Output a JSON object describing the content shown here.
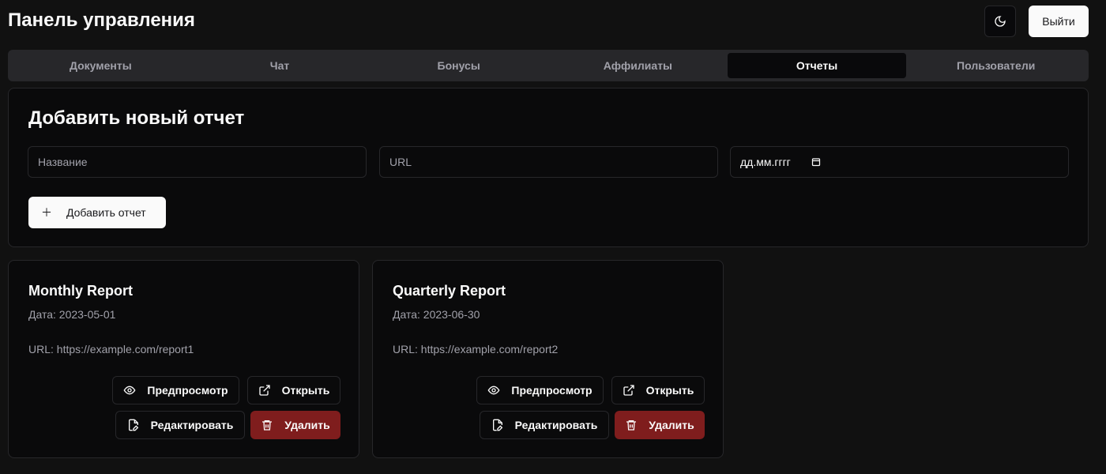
{
  "header": {
    "title": "Панель управления",
    "logout": "Выйти"
  },
  "tabs": [
    "Документы",
    "Чат",
    "Бонусы",
    "Аффилиаты",
    "Отчеты",
    "Пользователи"
  ],
  "active_tab": "Отчеты",
  "form": {
    "title": "Добавить новый отчет",
    "name_placeholder": "Название",
    "url_placeholder": "URL",
    "date_placeholder": "дд.мм.гггг",
    "add_button": "Добавить отчет"
  },
  "reports": [
    {
      "title": "Monthly Report",
      "date": "Дата: 2023-05-01",
      "url": "URL: https://example.com/report1"
    },
    {
      "title": "Quarterly Report",
      "date": "Дата: 2023-06-30",
      "url": "URL: https://example.com/report2"
    }
  ],
  "actions": {
    "preview": "Предпросмотр",
    "open": "Открыть",
    "edit": "Редактировать",
    "delete": "Удалить"
  },
  "colors": {
    "delete": "#7f1d1d",
    "background": "#111111"
  }
}
